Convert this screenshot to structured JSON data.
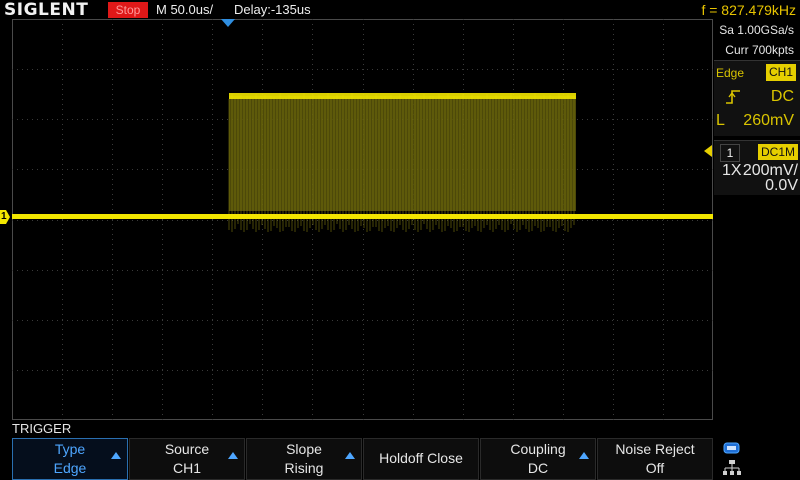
{
  "header": {
    "brand": "SIGLENT",
    "run_state": "Stop",
    "timebase": "M 50.0us/",
    "delay": "Delay:-135us",
    "frequency": "f = 827.479kHz"
  },
  "acquisition": {
    "sample_rate": "Sa 1.00GSa/s",
    "memory_depth": "Curr 700kpts"
  },
  "trigger_status": {
    "type": "Edge",
    "source": "CH1",
    "slope_icon": "rising-edge-icon",
    "coupling": "DC",
    "level_label": "L",
    "level": "260mV"
  },
  "channel": {
    "number": "1",
    "coupling_impedance": "DC1M",
    "probe": "1X",
    "volts_per_div": "200mV/",
    "offset": "0.0V",
    "marker_label": "1",
    "color": "#f2e600"
  },
  "menu": {
    "title": "TRIGGER",
    "softkeys": [
      {
        "line1": "Type",
        "line2": "Edge"
      },
      {
        "line1": "Source",
        "line2": "CH1"
      },
      {
        "line1": "Slope",
        "line2": "Rising"
      },
      {
        "line1": "Holdoff Close",
        "line2": ""
      },
      {
        "line1": "Coupling",
        "line2": "DC"
      },
      {
        "line1": "Noise Reject",
        "line2": "Off"
      }
    ]
  },
  "status_icons": [
    "usb-icon",
    "network-icon"
  ],
  "colors": {
    "trace": "#f2e600",
    "accent_blue": "#4ea6ff",
    "stop_red": "#e01818",
    "trigger_marker": "#2f8ee0"
  }
}
